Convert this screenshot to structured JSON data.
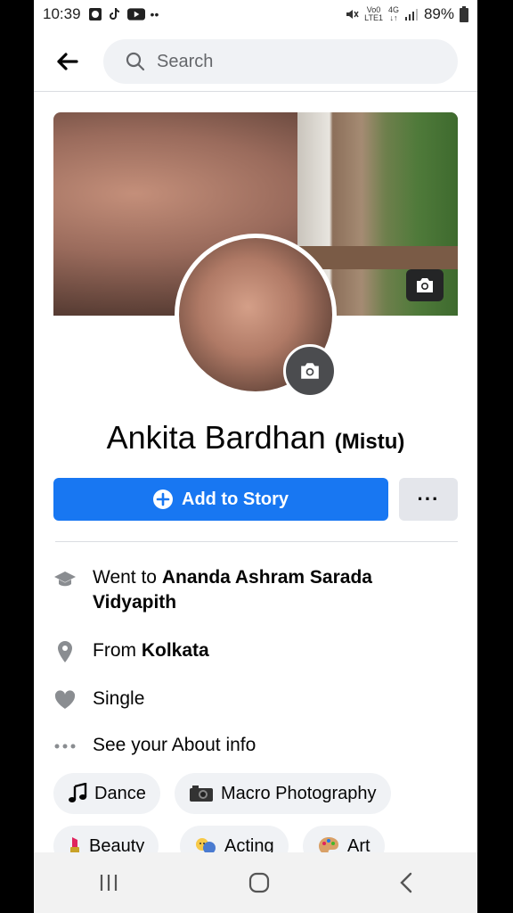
{
  "status_bar": {
    "time": "10:39",
    "battery": "89%",
    "network_top": "Vo0",
    "network_bottom": "LTE1",
    "signal": "4G"
  },
  "search": {
    "placeholder": "Search"
  },
  "profile": {
    "name": "Ankita Bardhan",
    "nickname": "(Mistu)"
  },
  "actions": {
    "add_story": "Add to Story",
    "more": "···"
  },
  "intro": {
    "education_prefix": "Went to ",
    "education_value": "Ananda Ashram Sarada Vidyapith",
    "from_prefix": "From ",
    "from_value": "Kolkata",
    "relationship": "Single",
    "about": "See your About info"
  },
  "hobbies": [
    {
      "label": "Dance",
      "icon": "music-note-icon"
    },
    {
      "label": "Macro Photography",
      "icon": "camera-icon"
    },
    {
      "label": "Beauty",
      "icon": "lipstick-icon"
    },
    {
      "label": "Acting",
      "icon": "theater-icon"
    },
    {
      "label": "Art",
      "icon": "palette-icon"
    }
  ],
  "colors": {
    "accent": "#1877f2",
    "chip_bg": "#f0f2f5",
    "text": "#050505"
  }
}
